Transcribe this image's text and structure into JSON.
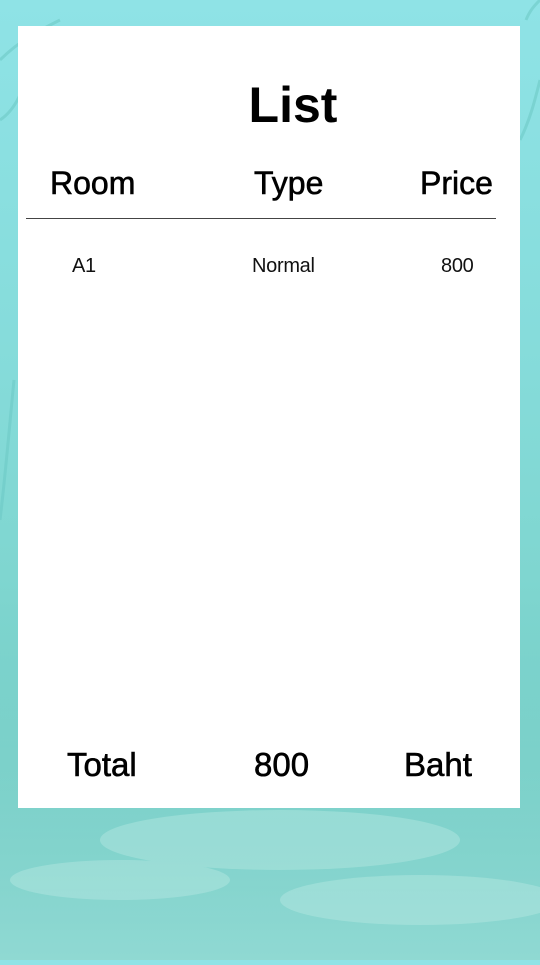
{
  "page": {
    "title": "List"
  },
  "table": {
    "headers": {
      "room": "Room",
      "type": "Type",
      "price": "Price"
    },
    "rows": [
      {
        "room": "A1",
        "type": "Normal",
        "price": "800"
      }
    ]
  },
  "footer": {
    "total_label": "Total",
    "total_value": "800",
    "currency": "Baht"
  },
  "colors": {
    "background": "#86dcdb",
    "card": "#ffffff",
    "text": "#000000"
  }
}
